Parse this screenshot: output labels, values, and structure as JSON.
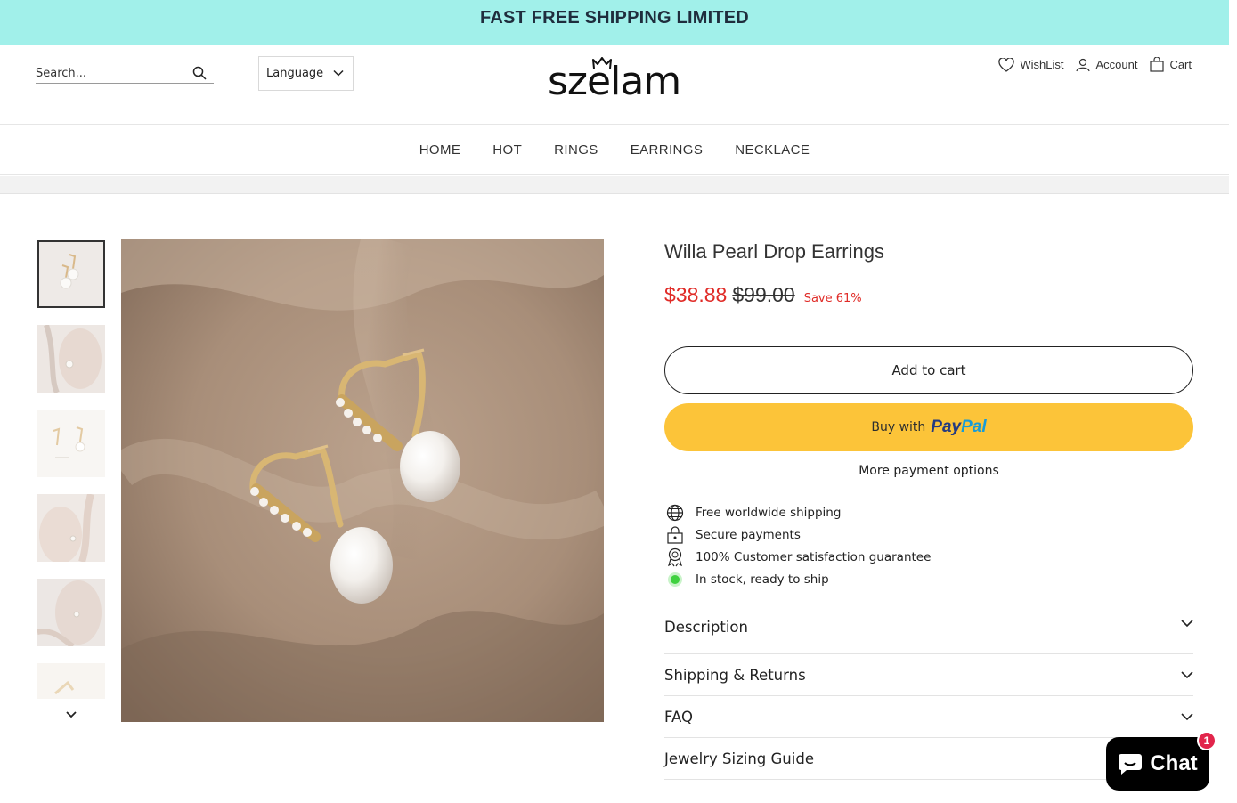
{
  "announcement": {
    "text": "FAST FREE SHIPPING LIMITED"
  },
  "header": {
    "search_placeholder": "Search...",
    "language_label": "Language",
    "logo_text": "szelam",
    "wishlist_label": "WishList",
    "account_label": "Account",
    "cart_label": "Cart"
  },
  "nav": {
    "items": [
      {
        "label": "HOME"
      },
      {
        "label": "HOT"
      },
      {
        "label": "RINGS"
      },
      {
        "label": "EARRINGS"
      },
      {
        "label": "NECKLACE"
      }
    ]
  },
  "product": {
    "title": "Willa Pearl Drop Earrings",
    "price_sale": "$38.88",
    "price_original": "$99.00",
    "save_label": "Save 61%",
    "add_to_cart_label": "Add to cart",
    "buy_with_label": "Buy with",
    "paypal_part1": "Pay",
    "paypal_part2": "Pal",
    "more_payment_label": "More payment options",
    "features": [
      {
        "icon": "globe-icon",
        "text": "Free worldwide shipping"
      },
      {
        "icon": "lock-icon",
        "text": "Secure payments"
      },
      {
        "icon": "award-icon",
        "text": "100% Customer satisfaction guarantee"
      },
      {
        "icon": "stock-dot-icon",
        "text": "In stock, ready to ship"
      }
    ],
    "accordion": [
      {
        "label": "Description"
      },
      {
        "label": "Shipping & Returns"
      },
      {
        "label": "FAQ"
      },
      {
        "label": "Jewelry Sizing Guide"
      }
    ]
  },
  "chat": {
    "label": "Chat",
    "badge": "1"
  },
  "colors": {
    "announcement_bg": "#a1f0ea",
    "sale_red": "#e02b27",
    "paypal_yellow": "#fcc439",
    "paypal_navy": "#253b80",
    "paypal_blue": "#179bd7",
    "stock_green": "#3fd13f"
  }
}
